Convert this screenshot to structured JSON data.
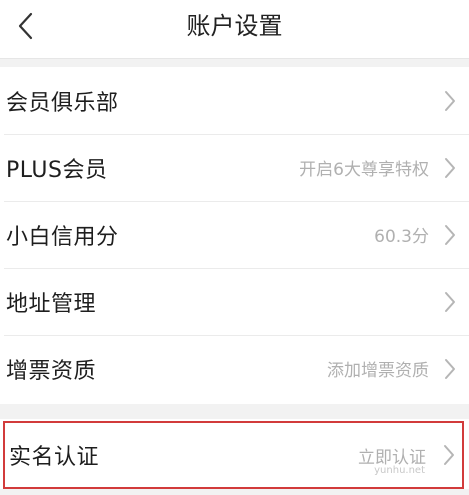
{
  "header": {
    "title": "账户设置",
    "back_icon": "chevron-left-icon"
  },
  "settings": {
    "items": [
      {
        "label": "会员俱乐部",
        "value": ""
      },
      {
        "label": "PLUS会员",
        "value": "开启6大尊享特权"
      },
      {
        "label": "小白信用分",
        "value": "60.3分"
      },
      {
        "label": "地址管理",
        "value": ""
      },
      {
        "label": "增票资质",
        "value": "添加增票资质"
      }
    ]
  },
  "verification": {
    "label": "实名认证",
    "value": "立即认证",
    "highlight_color": "#d23b3b"
  },
  "watermark": "yunhu.net"
}
